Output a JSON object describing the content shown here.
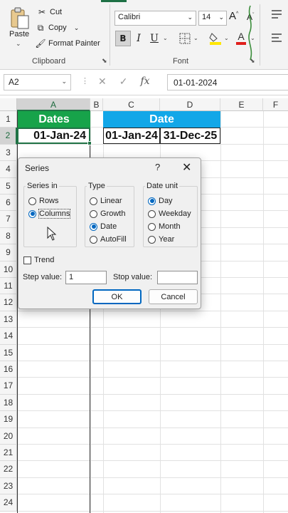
{
  "ribbon": {
    "clipboard": {
      "paste_label": "Paste",
      "cut_label": "Cut",
      "copy_label": "Copy",
      "format_painter_label": "Format Painter",
      "group_label": "Clipboard"
    },
    "font": {
      "font_name": "Calibri",
      "font_size": "14",
      "bold_label": "B",
      "italic_label": "I",
      "underline_label": "U",
      "grow_label": "A",
      "shrink_label": "A",
      "group_label": "Font",
      "fill_color": "#ffe600",
      "font_color": "#e0201c"
    }
  },
  "formula_bar": {
    "name_box": "A2",
    "fx_label": "fx",
    "formula": "01-01-2024"
  },
  "sheet": {
    "columns": [
      "A",
      "B",
      "C",
      "D",
      "E",
      "F"
    ],
    "rows": [
      "1",
      "2",
      "3",
      "4",
      "5",
      "6",
      "7",
      "8",
      "9",
      "10",
      "11",
      "12",
      "13",
      "14",
      "15",
      "16",
      "17",
      "18",
      "19",
      "20",
      "21",
      "22",
      "23",
      "24"
    ],
    "a1": "Dates",
    "a2": "01-Jan-24",
    "c1": "Date",
    "c2": "01-Jan-24",
    "d2": "31-Dec-25",
    "colors": {
      "dates_header": "#17a34a",
      "date_header": "#12a7e8"
    }
  },
  "dialog": {
    "title": "Series",
    "help": "?",
    "series_in": {
      "legend": "Series in",
      "options": [
        "Rows",
        "Columns"
      ],
      "selected": "Columns"
    },
    "type": {
      "legend": "Type",
      "options": [
        "Linear",
        "Growth",
        "Date",
        "AutoFill"
      ],
      "selected": "Date"
    },
    "date_unit": {
      "legend": "Date unit",
      "options": [
        "Day",
        "Weekday",
        "Month",
        "Year"
      ],
      "selected": "Day"
    },
    "trend_label": "Trend",
    "step_label": "Step value:",
    "step_value": "1",
    "stop_label": "Stop value:",
    "stop_value": "",
    "ok_label": "OK",
    "cancel_label": "Cancel"
  }
}
